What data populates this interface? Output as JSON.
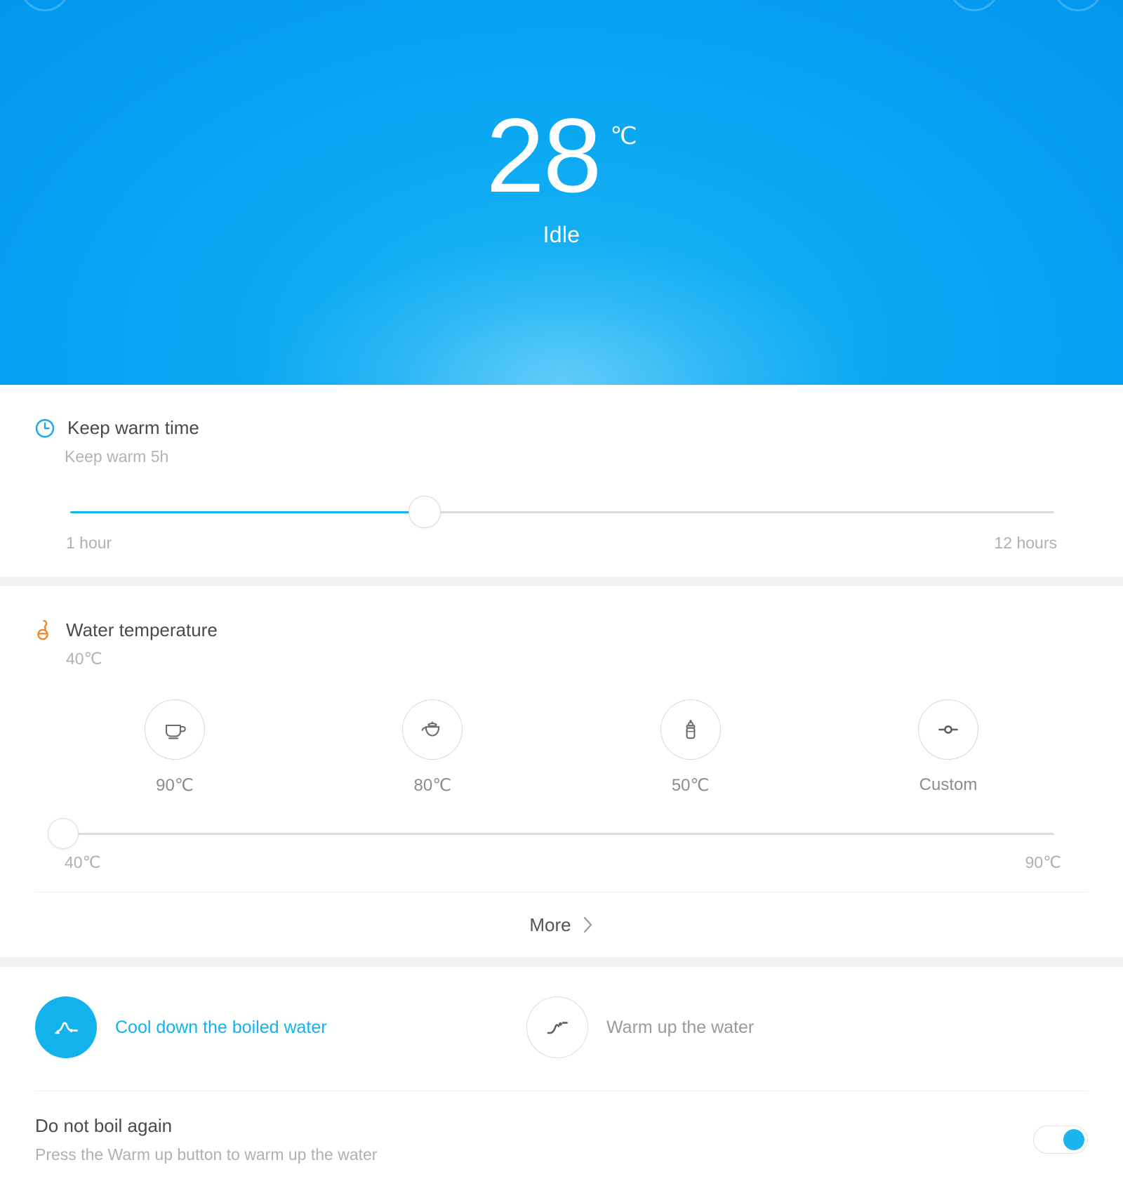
{
  "hero": {
    "temperature": "28",
    "unit": "℃",
    "status": "Idle",
    "accent_color": "#0aa7f2"
  },
  "keep_warm": {
    "icon": "clock-icon",
    "title": "Keep warm time",
    "subtitle": "Keep warm 5h",
    "slider": {
      "min_label": "1 hour",
      "max_label": "12 hours",
      "value_percent": 36,
      "fill_color": "#12b7ef"
    }
  },
  "water_temperature": {
    "icon": "thermometer-icon",
    "title": "Water temperature",
    "subtitle": "40℃",
    "presets": [
      {
        "icon": "cup-icon",
        "label": "90℃"
      },
      {
        "icon": "teapot-icon",
        "label": "80℃"
      },
      {
        "icon": "baby-bottle-icon",
        "label": "50℃"
      },
      {
        "icon": "slider-icon",
        "label": "Custom"
      }
    ],
    "slider": {
      "min_label": "40℃",
      "max_label": "90℃",
      "value_percent": 0
    }
  },
  "more": {
    "label": "More",
    "icon": "chevron-right-icon"
  },
  "actions": {
    "cool_down": {
      "icon": "cool-down-icon",
      "label": "Cool down the boiled water",
      "active": true,
      "color": "#14b2ec"
    },
    "warm_up": {
      "icon": "warm-up-icon",
      "label": "Warm up the water",
      "active": false,
      "color": "#9a9a9a"
    }
  },
  "do_not_boil": {
    "title": "Do not boil again",
    "subtitle": "Press the Warm up button to warm up the water",
    "toggle_on": true,
    "toggle_color": "#1cb4ed"
  }
}
